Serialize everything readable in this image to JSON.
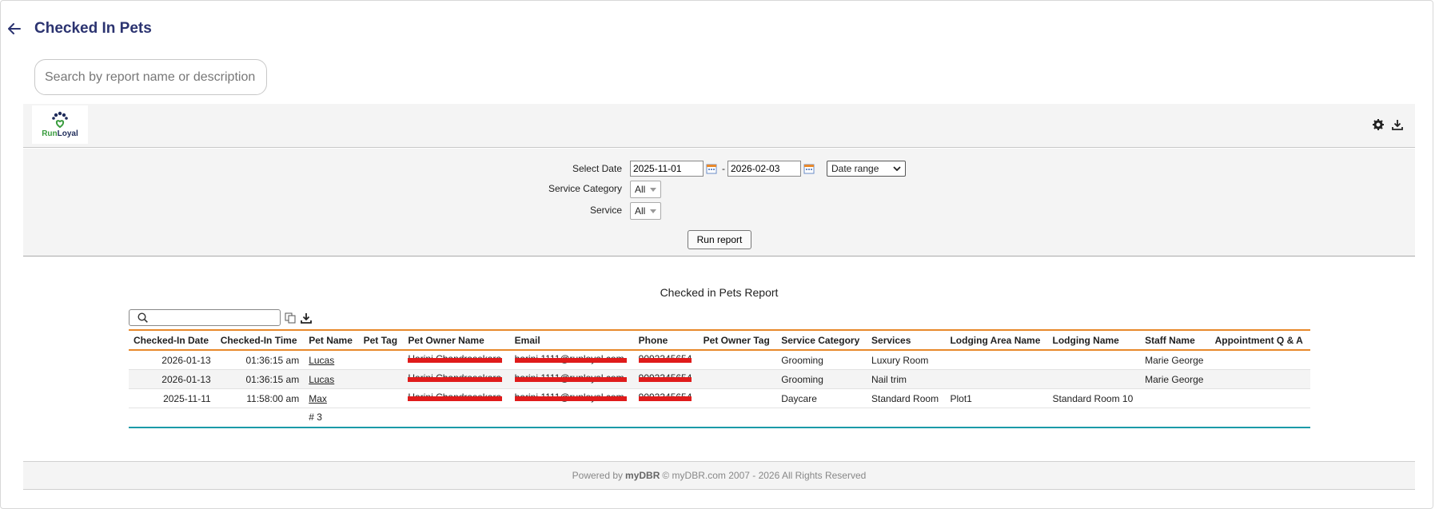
{
  "header": {
    "title": "Checked In Pets"
  },
  "search": {
    "placeholder": "Search by report name or description"
  },
  "logo": {
    "text_run": "Run",
    "text_loyal": "Loyal"
  },
  "filters": {
    "select_date_label": "Select Date",
    "date_from": "2025-11-01",
    "date_separator": "-",
    "date_to": "2026-02-03",
    "range_option": "Date range",
    "service_category_label": "Service Category",
    "service_category_value": "All",
    "service_label": "Service",
    "service_value": "All",
    "run_button": "Run report"
  },
  "report": {
    "title": "Checked in Pets Report",
    "columns": [
      "Checked-In Date",
      "Checked-In Time",
      "Pet Name",
      "Pet Tag",
      "Pet Owner Name",
      "Email",
      "Phone",
      "Pet Owner Tag",
      "Service Category",
      "Services",
      "Lodging Area Name",
      "Lodging Name",
      "Staff Name",
      "Appointment Q & A"
    ],
    "rows": [
      {
        "date": "2026-01-13",
        "time": "01:36:15 am",
        "pet": "Lucas",
        "pet_tag": "",
        "owner": "Harini Chandrasekaran",
        "email": "harini.1111@runloyal.com",
        "phone": "9092345654",
        "owner_tag": "",
        "category": "Grooming",
        "service": "Luxury Room",
        "area": "",
        "lodging": "",
        "staff": "Marie George",
        "qa": ""
      },
      {
        "date": "2026-01-13",
        "time": "01:36:15 am",
        "pet": "Lucas",
        "pet_tag": "",
        "owner": "Harini Chandrasekaran",
        "email": "harini.1111@runloyal.com",
        "phone": "9092345654",
        "owner_tag": "",
        "category": "Grooming",
        "service": "Nail trim",
        "area": "",
        "lodging": "",
        "staff": "Marie George",
        "qa": ""
      },
      {
        "date": "2025-11-11",
        "time": "11:58:00 am",
        "pet": "Max",
        "pet_tag": "",
        "owner": "Harini Chandrasekaran",
        "email": "harini.1111@runloyal.com",
        "phone": "9092345654",
        "owner_tag": "",
        "category": "Daycare",
        "service": "Standard Room",
        "area": "Plot1",
        "lodging": "Standard Room 10",
        "staff": "",
        "qa": ""
      }
    ],
    "count_label": "# 3"
  },
  "footer": {
    "powered_by": "Powered by",
    "brand": "myDBR",
    "copyright": "© myDBR.com 2007 - 2026 All Rights Reserved"
  },
  "colors": {
    "title": "#2b3370",
    "header_rule": "#e8892b",
    "footer_rule": "#1b9aa8",
    "redaction": "#e01b1b"
  }
}
